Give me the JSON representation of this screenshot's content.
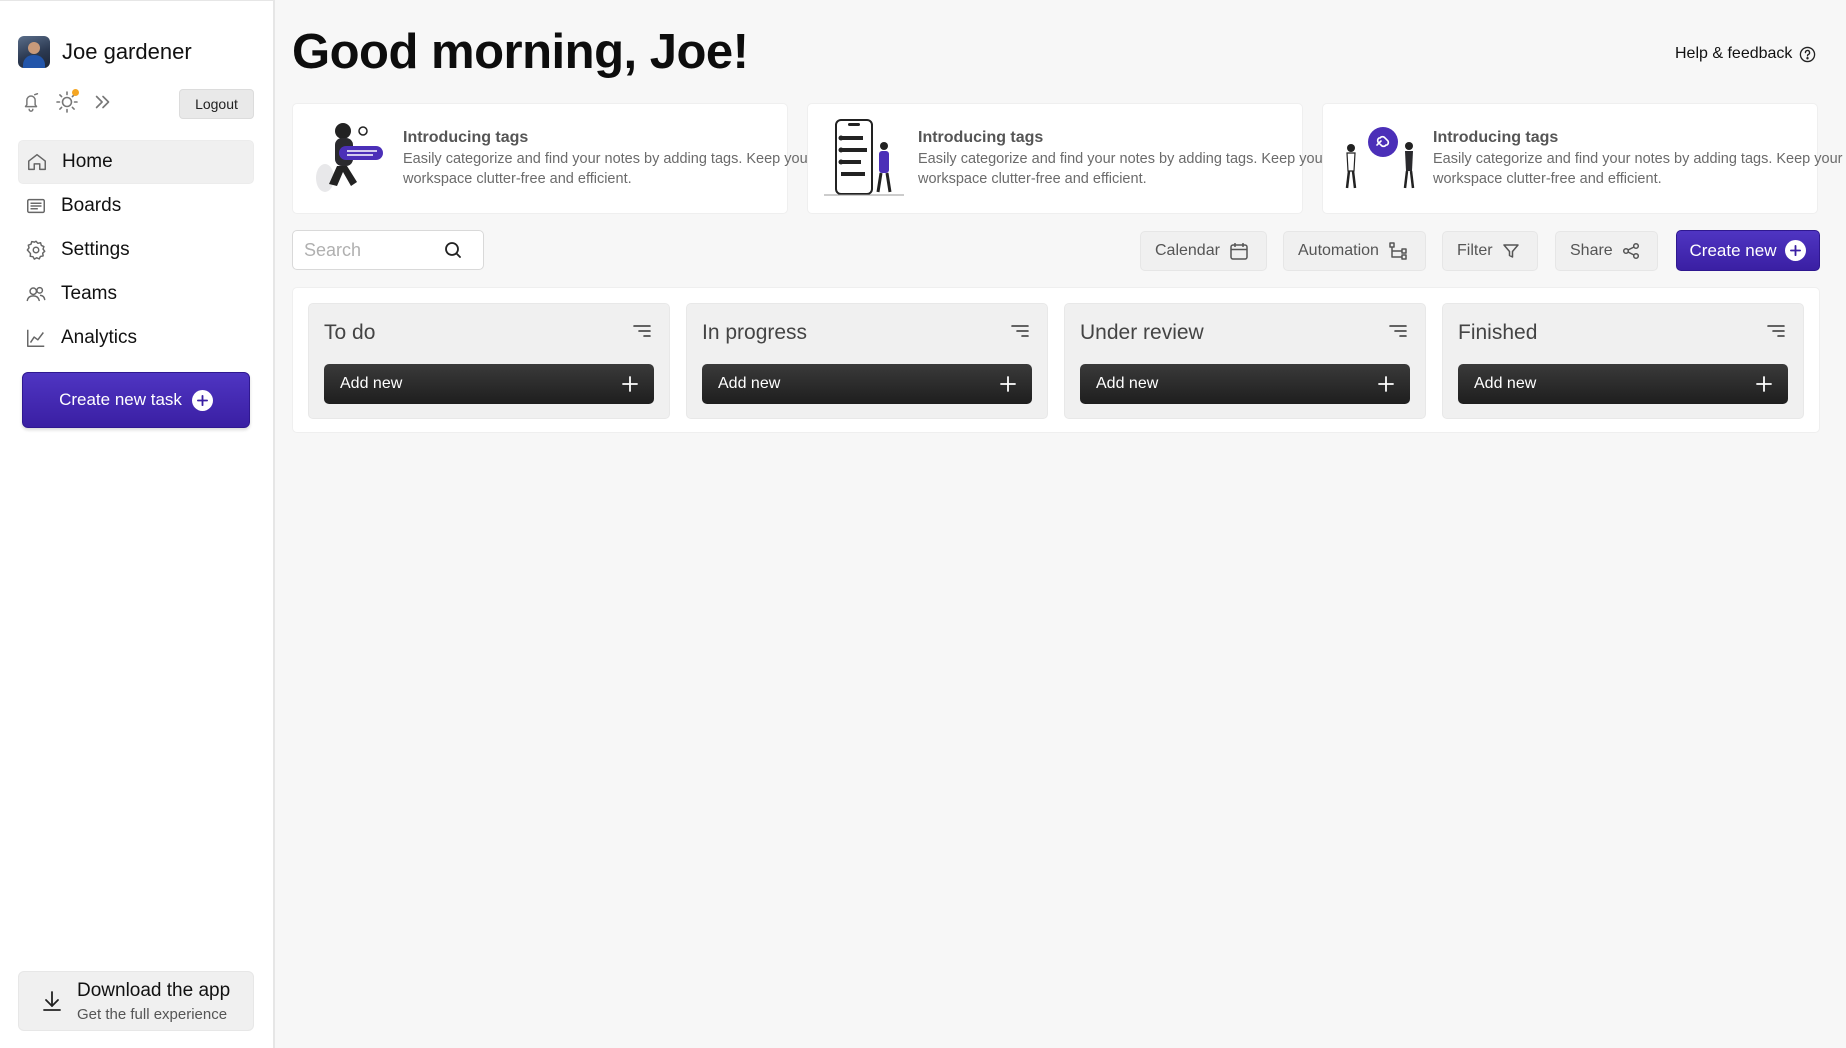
{
  "user": {
    "name": "Joe gardener"
  },
  "sidebar": {
    "logout_label": "Logout",
    "nav": [
      {
        "label": "Home",
        "icon": "home-icon",
        "active": true
      },
      {
        "label": "Boards",
        "icon": "boards-icon"
      },
      {
        "label": "Settings",
        "icon": "settings-icon"
      },
      {
        "label": "Teams",
        "icon": "teams-icon"
      },
      {
        "label": "Analytics",
        "icon": "analytics-icon"
      }
    ],
    "create_task_label": "Create new task",
    "download": {
      "title": "Download the app",
      "subtitle": "Get the full experience"
    }
  },
  "header": {
    "greeting": "Good morning, Joe!",
    "help_label": "Help & feedback"
  },
  "cards": [
    {
      "title": "Introducing tags",
      "description": "Easily categorize and find your notes by adding tags. Keep your workspace clutter-free and efficient."
    },
    {
      "title": "Introducing tags",
      "description": "Easily categorize and find your notes by adding tags. Keep your workspace clutter-free and efficient."
    },
    {
      "title": "Introducing tags",
      "description": "Easily categorize and find your notes by adding tags. Keep your workspace clutter-free and efficient."
    }
  ],
  "toolbar": {
    "search_placeholder": "Search",
    "calendar_label": "Calendar",
    "automation_label": "Automation",
    "filter_label": "Filter",
    "share_label": "Share",
    "create_new_label": "Create new"
  },
  "columns": [
    {
      "title": "To do",
      "add_label": "Add new"
    },
    {
      "title": "In progress",
      "add_label": "Add new"
    },
    {
      "title": "Under review",
      "add_label": "Add new"
    },
    {
      "title": "Finished",
      "add_label": "Add new"
    }
  ],
  "colors": {
    "accent": "#4b2fb8",
    "dark_button": "#2a2a2a",
    "notification_dot": "#f5a623"
  }
}
